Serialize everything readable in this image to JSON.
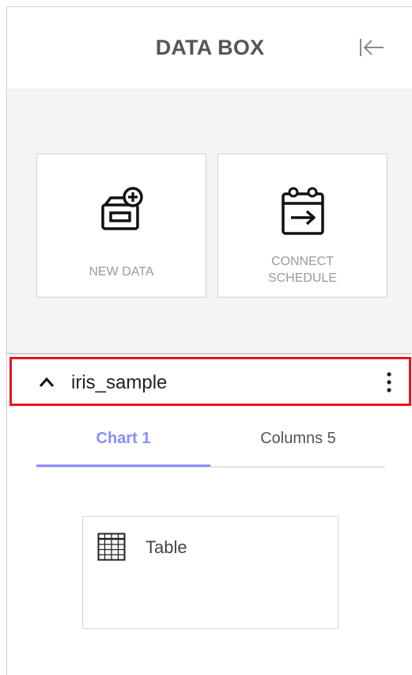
{
  "header": {
    "title": "DATA BOX",
    "collapse_icon": "collapse-left-icon"
  },
  "actions": {
    "new_data_label": "NEW DATA",
    "new_data_icon": "add-database-icon",
    "connect_schedule_label": "CONNECT\nSCHEDULE",
    "connect_schedule_icon": "calendar-arrow-icon"
  },
  "dataset": {
    "name": "iris_sample",
    "expand_icon": "chevron-up-icon",
    "menu_icon": "more-vertical-icon",
    "highlight_color": "#e8141e"
  },
  "tabs": [
    {
      "label": "Chart 1",
      "active": true
    },
    {
      "label": "Columns 5",
      "active": false
    }
  ],
  "accent_color": "#8a8eff",
  "charts": [
    {
      "label": "Table",
      "icon": "table-grid-icon"
    }
  ]
}
